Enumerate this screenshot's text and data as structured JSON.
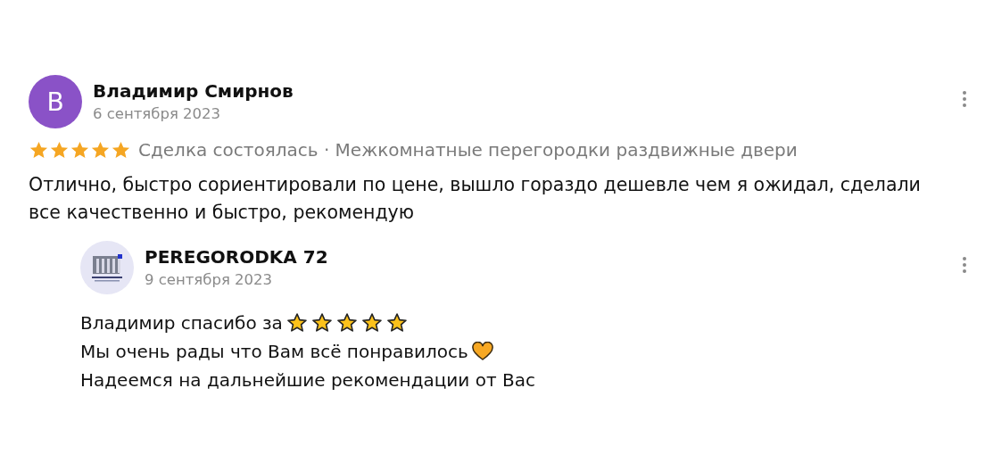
{
  "review": {
    "avatar_letter": "В",
    "author": "Владимир Смирнов",
    "date": "6 сентября 2023",
    "stars": 5,
    "meta": "Сделка состоялась · Межкомнатные перегородки раздвижные двери",
    "text": "Отлично, быстро сориентировали по цене, вышло гораздо дешевле чем я ожидал, сделали все качественно и быстро, рекомендую"
  },
  "reply": {
    "author": "PEREGORODKA 72",
    "date": "9 сентября 2023",
    "lines": [
      {
        "kind": "stars",
        "text": "Владимир спасибо за"
      },
      {
        "kind": "heart",
        "text": "Мы очень рады что Вам всё понравилось"
      },
      {
        "kind": "plain",
        "text": "Надеемся на дальнейшие рекомендации от Вас"
      }
    ]
  }
}
